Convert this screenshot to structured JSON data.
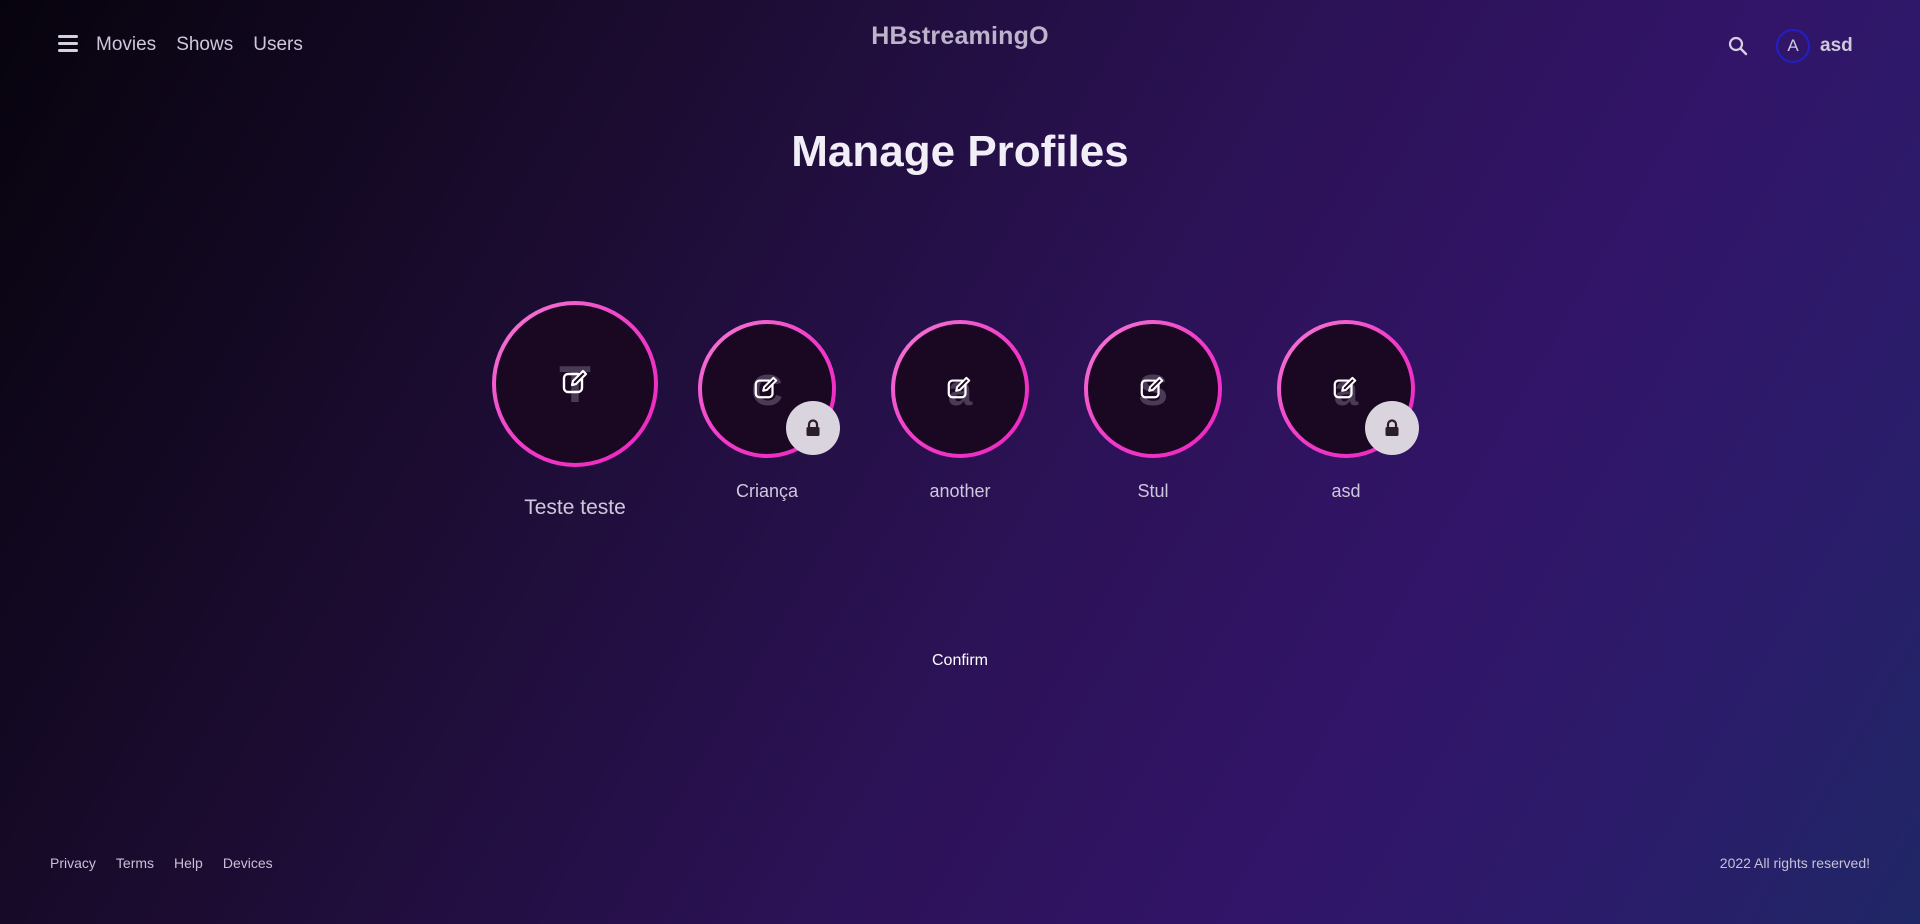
{
  "header": {
    "nav": [
      "Movies",
      "Shows",
      "Users"
    ],
    "brand": "HBstreamingO",
    "avatar_initial": "A",
    "username": "asd"
  },
  "main": {
    "title": "Manage Profiles",
    "profiles": [
      {
        "name": "Teste teste",
        "initial": "T",
        "locked": false,
        "selected": true
      },
      {
        "name": "Criança",
        "initial": "C",
        "locked": true,
        "selected": false
      },
      {
        "name": "another",
        "initial": "a",
        "locked": false,
        "selected": false
      },
      {
        "name": "Stul",
        "initial": "S",
        "locked": false,
        "selected": false
      },
      {
        "name": "asd",
        "initial": "a",
        "locked": true,
        "selected": false
      }
    ],
    "confirm_label": "Confirm"
  },
  "footer": {
    "links": [
      "Privacy",
      "Terms",
      "Help",
      "Devices"
    ],
    "copyright": "2022 All rights reserved!"
  },
  "colors": {
    "ring_gradient": "#f03cc8",
    "circle_fill": "#1a0722",
    "avatar_border": "#2020c8",
    "lock_badge": "#d9d4de"
  },
  "icons": [
    "menu-icon",
    "search-icon",
    "edit-icon",
    "lock-icon"
  ]
}
